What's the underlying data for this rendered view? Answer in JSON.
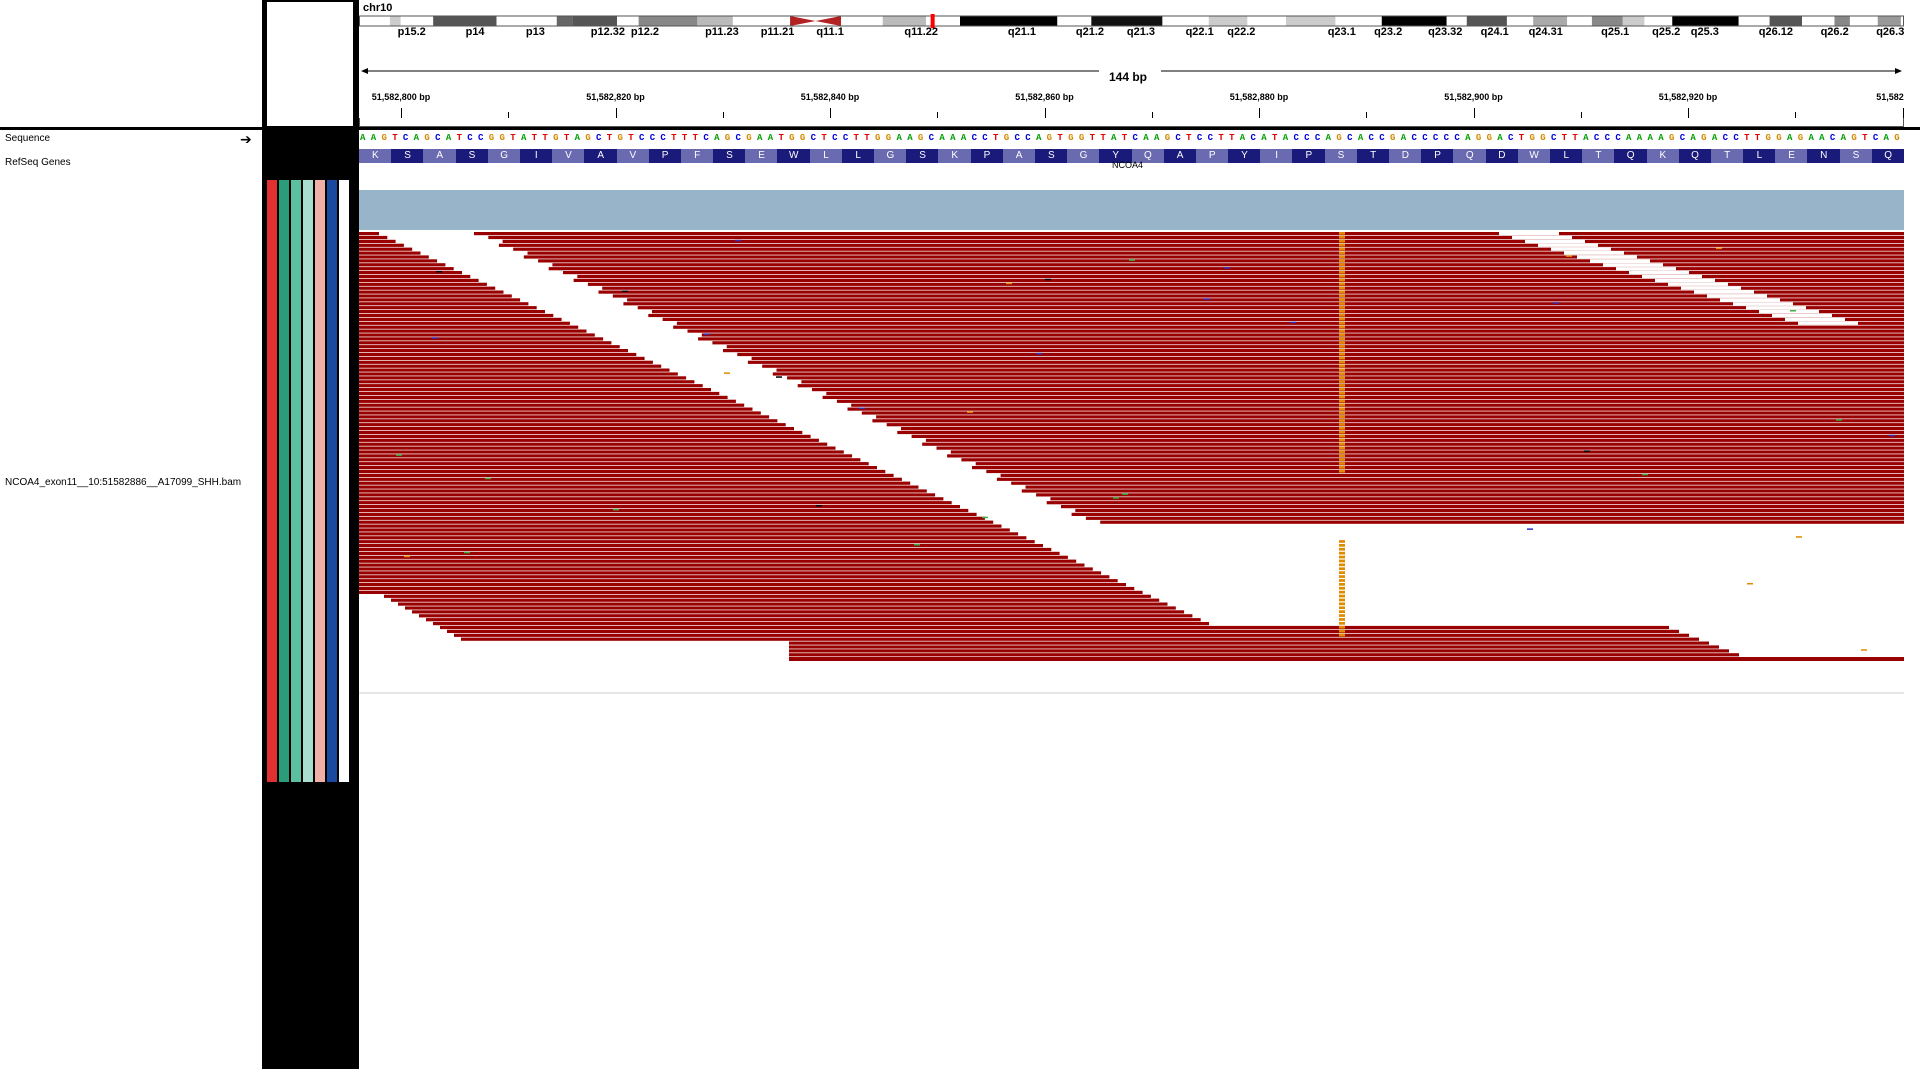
{
  "ideogram": {
    "chromosome": "chr10",
    "bands": [
      "p15.2",
      "p14",
      "p13",
      "p12.32",
      "p12.2",
      "p11.23",
      "p11.21",
      "q11.1",
      "q11.22",
      "q21.1",
      "q21.2",
      "q21.3",
      "q22.1",
      "q22.2",
      "q23.1",
      "q23.2",
      "q23.32",
      "q24.1",
      "q24.31",
      "q25.1",
      "q25.2",
      "q25.3",
      "q26.12",
      "q26.2",
      "q26.3"
    ]
  },
  "ruler": {
    "span_label": "144 bp",
    "ticks": [
      "51,582,800 bp",
      "51,582,820 bp",
      "51,582,840 bp",
      "51,582,860 bp",
      "51,582,880 bp",
      "51,582,900 bp",
      "51,582,920 bp",
      "51,582"
    ]
  },
  "tracks": {
    "sequence_label": "Sequence",
    "genes_label": "RefSeq Genes",
    "bam_label": "NCOA4_exon11__10:51582886__A17099_SHH.bam",
    "gene_name": "NCOA4",
    "strand_arrow": "right-arrow-icon"
  },
  "sequence": "AAGTCAGCATCCGGTATTGTAGCTGTCCCTTTCAGCGAATGGCTCCTTGGAAGCAAACCTGCCAGTGGTTATCAAGCTCCTTACATACCCAGCACCGACCCCCAGGACTGGCTTACCCAAAAGCAGACCTTGGAGAACAGTCAG",
  "amino_acids": [
    "K",
    "S",
    "A",
    "S",
    "G",
    "I",
    "V",
    "A",
    "V",
    "P",
    "F",
    "S",
    "E",
    "W",
    "L",
    "L",
    "G",
    "S",
    "K",
    "P",
    "A",
    "S",
    "G",
    "Y",
    "Q",
    "A",
    "P",
    "Y",
    "I",
    "P",
    "S",
    "T",
    "D",
    "P",
    "Q",
    "D",
    "W",
    "L",
    "T",
    "Q",
    "K",
    "Q",
    "T",
    "L",
    "E",
    "N",
    "S",
    "Q"
  ],
  "colors": {
    "read": "#990000",
    "coverage": "#98b4c8",
    "mismatch": "#e08a00",
    "base_A": "#00a000",
    "base_C": "#0000e0",
    "base_G": "#d18a00",
    "base_T": "#e00000",
    "aa_dark": "#1a1a7a",
    "aa_light": "#6a6ab0",
    "attr_1": "#e03030",
    "attr_2": "#2a9d78",
    "attr_3": "#5cc0a0",
    "attr_4": "#a8ddd0",
    "attr_5": "#f0b0a8",
    "attr_6": "#1a4aa0",
    "attr_7": "#ffffff"
  }
}
